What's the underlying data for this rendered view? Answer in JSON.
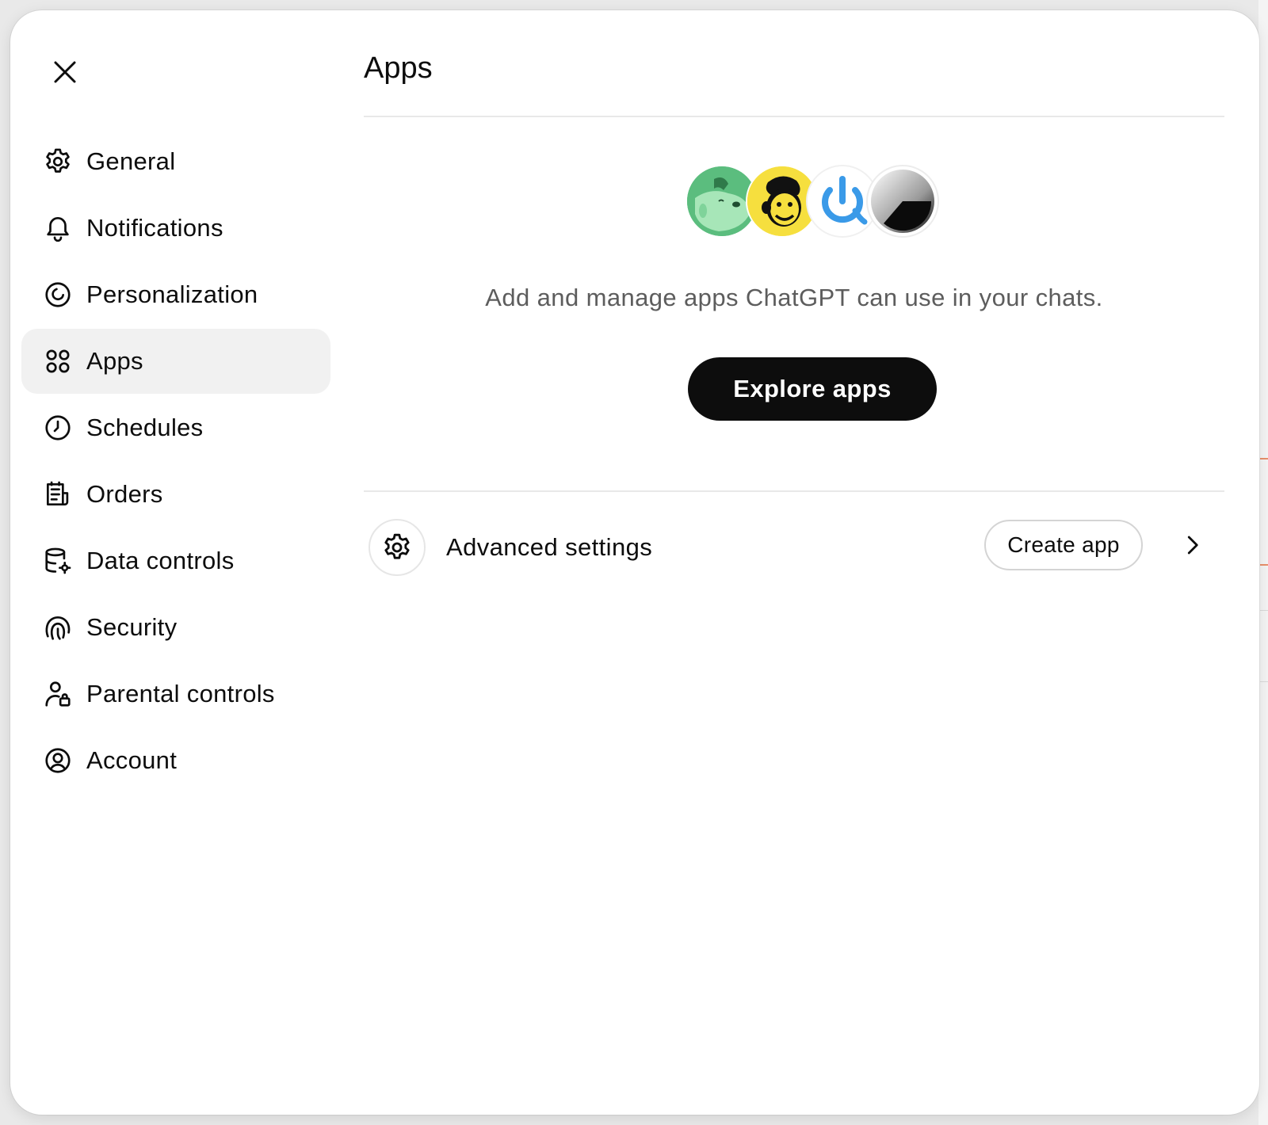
{
  "dialog": {
    "close_icon": "close-icon"
  },
  "sidebar": {
    "items": [
      {
        "label": "General",
        "icon": "gear-icon",
        "active": false
      },
      {
        "label": "Notifications",
        "icon": "bell-icon",
        "active": false
      },
      {
        "label": "Personalization",
        "icon": "personalization-icon",
        "active": false
      },
      {
        "label": "Apps",
        "icon": "apps-grid-icon",
        "active": true
      },
      {
        "label": "Schedules",
        "icon": "clock-icon",
        "active": false
      },
      {
        "label": "Orders",
        "icon": "receipt-icon",
        "active": false
      },
      {
        "label": "Data controls",
        "icon": "database-gear-icon",
        "active": false
      },
      {
        "label": "Security",
        "icon": "fingerprint-icon",
        "active": false
      },
      {
        "label": "Parental controls",
        "icon": "user-lock-icon",
        "active": false
      },
      {
        "label": "Account",
        "icon": "user-circle-icon",
        "active": false
      }
    ]
  },
  "main": {
    "title": "Apps",
    "app_logos": [
      "green-dog-app-logo",
      "mailchimp-logo",
      "power-app-logo",
      "gradient-app-logo"
    ],
    "description": "Add and manage apps ChatGPT can use in your chats.",
    "explore_label": "Explore apps",
    "advanced": {
      "label": "Advanced settings",
      "icon": "gear-icon",
      "create_label": "Create app",
      "chevron_icon": "chevron-right-icon"
    }
  },
  "colors": {
    "primary_button": "#0d0d0d",
    "active_nav": "#f1f1f1",
    "muted_text": "#5d5d5d",
    "divider": "#e8e8e8"
  }
}
